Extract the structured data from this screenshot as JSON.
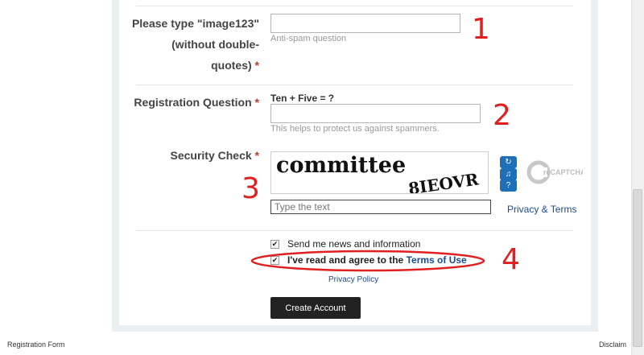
{
  "antispam": {
    "label_line1": "Please type \"image123\"",
    "label_line2": "(without double-",
    "label_line3": "quotes)",
    "required_mark": "*",
    "value": "",
    "hint": "Anti-spam question"
  },
  "registration_question": {
    "label": "Registration Question",
    "required_mark": "*",
    "question": "Ten + Five = ?",
    "value": "",
    "hint": "This helps to protect us against spammers."
  },
  "security_check": {
    "label": "Security Check",
    "required_mark": "*",
    "captcha_word": "committee",
    "captcha_distorted": "8IEOVR",
    "input_placeholder": "Type the text",
    "privacy_terms": "Privacy & Terms",
    "refresh_icon": "refresh-icon",
    "audio_icon": "audio-icon",
    "help_icon": "help-icon",
    "logo_text": "reCAPTCHA™"
  },
  "newsletter": {
    "label": "Send me news and information",
    "checked": true
  },
  "terms": {
    "label_prefix": "I've read and agree to the",
    "link": "Terms of Use",
    "checked": true
  },
  "privacy_policy": "Privacy Policy",
  "submit_label": "Create Account",
  "footer": {
    "left": "Registration Form",
    "right": "Disclaim"
  },
  "annotations": {
    "n1": "1",
    "n2": "2",
    "n3": "3",
    "n4": "4",
    "color": "#e02020"
  }
}
